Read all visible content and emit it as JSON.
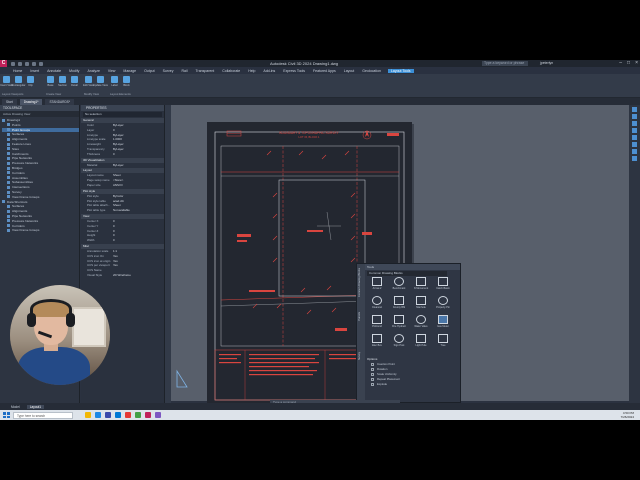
{
  "window": {
    "title": "Autodesk Civil 3D 2024   Drawing1.dwg",
    "search_placeholder": "Type a keyword or phrase",
    "user": "jpeterlyn"
  },
  "menu_tabs": [
    "Home",
    "Insert",
    "Annotate",
    "Modify",
    "Analyze",
    "View",
    "Manage",
    "Output",
    "Survey",
    "Rail",
    "Transparent",
    "Collaborate",
    "Help",
    "Add-ins",
    "Express Tools",
    "Featured Apps",
    "Layout",
    "Geolocation",
    "Layout Tools"
  ],
  "active_menu_tab": "Layout Tools",
  "ribbon": {
    "groups": [
      {
        "title": "Layout Viewports",
        "buttons": [
          "Insert View",
          "Rectangular",
          "Clip"
        ]
      },
      {
        "title": "Create View",
        "buttons": [
          "Base",
          "Section",
          "Detail"
        ]
      },
      {
        "title": "Modify View",
        "buttons": [
          "Edit View",
          "Update View"
        ]
      },
      {
        "title": "Layout Elements",
        "buttons": [
          "Label",
          "Block"
        ]
      }
    ]
  },
  "doc_tabs": [
    "Start",
    "Drawing1*",
    "STANDARDS*"
  ],
  "active_doc_tab": "Drawing1*",
  "toolspace": {
    "header": "TOOLSPACE",
    "subheader": "Active Drawing View",
    "tree": [
      "Drawing1",
      "Points",
      "Point Groups",
      "Surfaces",
      "Alignments",
      "Feature Lines",
      "Sites",
      "Catchments",
      "Pipe Networks",
      "Pressure Networks",
      "Bridges",
      "Corridors",
      "Assemblies",
      "Subassemblies",
      "Intersections",
      "Survey",
      "View Frame Groups",
      "Data Shortcuts",
      "Surfaces",
      "Alignments",
      "Pipe Networks",
      "Pressure Networks",
      "Corridors",
      "View Frame Groups"
    ],
    "selected_index": 2,
    "bottom_rows": [
      "Pipe Networks",
      "Parcels",
      "Pipe Networks"
    ]
  },
  "properties": {
    "header": "PROPERTIES",
    "selection": "No selection",
    "groups": [
      {
        "name": "General",
        "rows": [
          [
            "Color",
            "ByLayer"
          ],
          [
            "Layer",
            "0"
          ],
          [
            "Linetype",
            "ByLayer"
          ],
          [
            "Linetype scale",
            "1.0000"
          ],
          [
            "Lineweight",
            "ByLayer"
          ],
          [
            "Transparency",
            "ByLayer"
          ],
          [
            "Thickness",
            "0"
          ]
        ]
      },
      {
        "name": "3D Visualization",
        "rows": [
          [
            "Material",
            "ByLayer"
          ]
        ]
      },
      {
        "name": "Layout",
        "rows": [
          [
            "Layout name",
            "Sheet"
          ],
          [
            "Page setup name",
            "<None>"
          ],
          [
            "Paper size",
            "ANSI D"
          ]
        ]
      },
      {
        "name": "Plot style",
        "rows": [
          [
            "Plot style",
            "ByColor"
          ],
          [
            "Plot style table",
            "acad.ctb"
          ],
          [
            "Plot table attach...",
            "Sheet"
          ],
          [
            "Plot table type",
            "Not available"
          ]
        ]
      },
      {
        "name": "View",
        "rows": [
          [
            "Center X",
            "0"
          ],
          [
            "Center Y",
            "0"
          ],
          [
            "Center Z",
            "0"
          ],
          [
            "Height",
            "0"
          ],
          [
            "Width",
            "0"
          ]
        ]
      },
      {
        "name": "Misc",
        "rows": [
          [
            "Annotation scale",
            "1:1"
          ],
          [
            "UCS icon On",
            "Yes"
          ],
          [
            "UCS icon at origin",
            "Yes"
          ],
          [
            "UCS per viewport",
            "Yes"
          ],
          [
            "UCS Name",
            ""
          ],
          [
            "Visual Style",
            "2D Wireframe"
          ]
        ]
      }
    ]
  },
  "tool_palette": {
    "side_tabs": [
      "Common Drawing Blocks",
      "Parcels",
      "Survey"
    ],
    "header": "Tools",
    "category": "Common Drawing Blocks",
    "blocks": [
      "Arrow-2",
      "Benchmark",
      "N Monument",
      "Catch Basin",
      "Cleanout",
      "County BM",
      "Manhole",
      "Property Pin",
      "Pinfound",
      "Fire Hydrant",
      "Water Valve",
      "Gas Meter",
      "Elec Box",
      "Sign Post",
      "Light Pole",
      "Tree"
    ],
    "selected_block_index": 11,
    "options_title": "Options",
    "options": [
      "Insertion Point",
      "Rotation",
      "Scale Uniformly",
      "Repeat Placement",
      "Explode"
    ]
  },
  "layout_tabs": [
    "Model",
    "Layout1"
  ],
  "active_layout_tab": "Layout1",
  "command_line": "Type a command",
  "taskbar": {
    "search_placeholder": "Type here to search",
    "time": "4:50 PM",
    "date": "7/26/2024"
  },
  "sheet_title": {
    "line1": "BOUNDARY & TOPOGRAPHIC SURVEY",
    "line2": "LOT 15, BLOCK 1"
  },
  "colors": {
    "accent": "#3b8fd6",
    "drawing_red": "#d9453f",
    "drawing_white": "#d9dde3"
  },
  "icons": [
    "app-icon",
    "search-icon",
    "close-icon",
    "north-arrow-icon",
    "windows-start-icon"
  ]
}
